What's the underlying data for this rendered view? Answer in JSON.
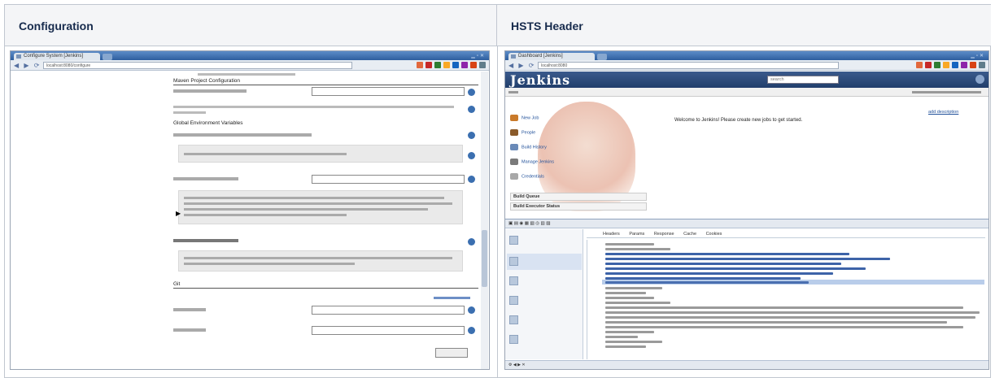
{
  "table": {
    "headers": [
      "Configuration",
      "HSTS Header"
    ]
  },
  "left_screenshot": {
    "tab_title": "Configure System [Jenkins]",
    "url": "localhost:8080/configure",
    "sections": [
      {
        "heading": "Maven Project Configuration"
      },
      {
        "heading": "Global Environment Variables"
      },
      {
        "heading": "Git"
      }
    ]
  },
  "right_screenshot": {
    "tab_title": "Dashboard [Jenkins]",
    "url": "localhost:8080",
    "logo": "Jenkins",
    "search_placeholder": "search",
    "tasks": [
      "New Job",
      "People",
      "Build History",
      "Manage Jenkins",
      "Credentials"
    ],
    "queue_labels": [
      "Build Queue",
      "Build Executor Status"
    ],
    "welcome": "Welcome to Jenkins! Please create new jobs to get started.",
    "edit_link": "add description",
    "devtools_tabs": [
      "Headers",
      "Params",
      "Response",
      "Cache",
      "Cookies"
    ]
  },
  "icon_colors": [
    "#e2683c",
    "#c62828",
    "#2e7d32",
    "#f9a825",
    "#1565c0",
    "#8e24aa",
    "#d84315",
    "#00838f"
  ]
}
